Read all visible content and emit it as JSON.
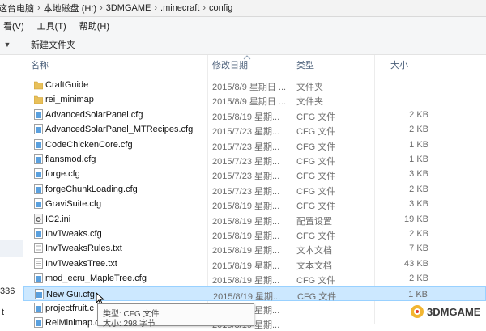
{
  "breadcrumb": {
    "items": [
      "这台电脑",
      "本地磁盘 (H:)",
      "3DMGAME",
      ".minecraft",
      "config"
    ],
    "separator": "›",
    "first_partial": "这台电脑"
  },
  "menu": {
    "view": "看(V)",
    "tools": "工具(T)",
    "help": "帮助(H)"
  },
  "toolbar": {
    "new_folder": "新建文件夹"
  },
  "nav": {
    "frag_336": "336",
    "frag_t": "t"
  },
  "columns": {
    "name": "名称",
    "date": "修改日期",
    "type": "类型",
    "size": "大小"
  },
  "files": [
    {
      "name": "CraftGuide",
      "date": "2015/8/9 星期日 ...",
      "type": "文件夹",
      "size": "",
      "icon": "folder-icon"
    },
    {
      "name": "rei_minimap",
      "date": "2015/8/9 星期日 ...",
      "type": "文件夹",
      "size": "",
      "icon": "folder-icon"
    },
    {
      "name": "AdvancedSolarPanel.cfg",
      "date": "2015/8/19 星期...",
      "type": "CFG 文件",
      "size": "2 KB",
      "icon": "cfg-file-icon"
    },
    {
      "name": "AdvancedSolarPanel_MTRecipes.cfg",
      "date": "2015/7/23 星期...",
      "type": "CFG 文件",
      "size": "2 KB",
      "icon": "cfg-file-icon"
    },
    {
      "name": "CodeChickenCore.cfg",
      "date": "2015/7/23 星期...",
      "type": "CFG 文件",
      "size": "1 KB",
      "icon": "cfg-file-icon"
    },
    {
      "name": "flansmod.cfg",
      "date": "2015/7/23 星期...",
      "type": "CFG 文件",
      "size": "1 KB",
      "icon": "cfg-file-icon"
    },
    {
      "name": "forge.cfg",
      "date": "2015/7/23 星期...",
      "type": "CFG 文件",
      "size": "3 KB",
      "icon": "cfg-file-icon"
    },
    {
      "name": "forgeChunkLoading.cfg",
      "date": "2015/7/23 星期...",
      "type": "CFG 文件",
      "size": "2 KB",
      "icon": "cfg-file-icon"
    },
    {
      "name": "GraviSuite.cfg",
      "date": "2015/8/19 星期...",
      "type": "CFG 文件",
      "size": "3 KB",
      "icon": "cfg-file-icon"
    },
    {
      "name": "IC2.ini",
      "date": "2015/8/19 星期...",
      "type": "配置设置",
      "size": "19 KB",
      "icon": "ini-settings-icon"
    },
    {
      "name": "InvTweaks.cfg",
      "date": "2015/8/19 星期...",
      "type": "CFG 文件",
      "size": "2 KB",
      "icon": "cfg-file-icon"
    },
    {
      "name": "InvTweaksRules.txt",
      "date": "2015/8/19 星期...",
      "type": "文本文档",
      "size": "7 KB",
      "icon": "text-file-icon"
    },
    {
      "name": "InvTweaksTree.txt",
      "date": "2015/8/19 星期...",
      "type": "文本文档",
      "size": "43 KB",
      "icon": "text-file-icon"
    },
    {
      "name": "mod_ecru_MapleTree.cfg",
      "date": "2015/8/19 星期...",
      "type": "CFG 文件",
      "size": "2 KB",
      "icon": "cfg-file-icon"
    },
    {
      "name": "New Gui.cfg",
      "date": "2015/8/19 星期...",
      "type": "CFG 文件",
      "size": "1 KB",
      "icon": "cfg-file-icon",
      "selected": true
    },
    {
      "name": "projectfruit.c",
      "date": "2015/8/19 星期...",
      "type": "",
      "size": "",
      "icon": "cfg-file-icon"
    },
    {
      "name": "ReiMinimap.c",
      "date": "2015/8/19 星期...",
      "type": "",
      "size": "",
      "icon": "cfg-file-icon"
    }
  ],
  "tooltip": {
    "type_line": "类型: CFG 文件",
    "size_line": "大小: 298 字节"
  },
  "watermark": {
    "text": "3DMGAME"
  },
  "colors": {
    "selection": "#cce8ff",
    "selection_border": "#99d1ff",
    "header_text": "#4c607a",
    "folder": "#e8c05a",
    "cfg_icon": "#3d8fd8"
  }
}
